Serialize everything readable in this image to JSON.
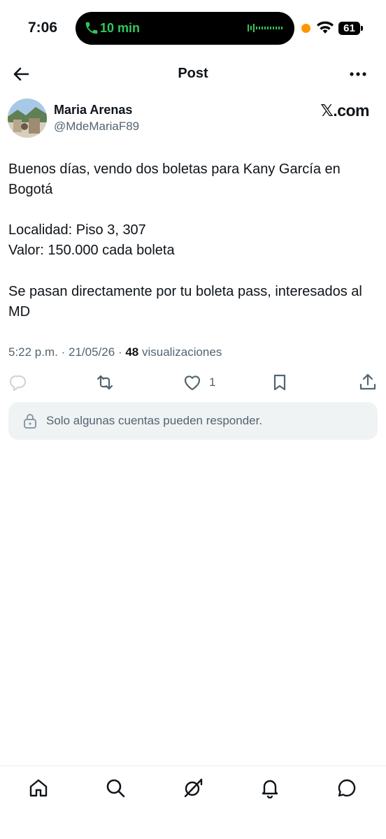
{
  "status_bar": {
    "time": "7:06",
    "call_duration": "10 min",
    "battery": "61",
    "call_color": "#34c759",
    "recording_dot_color": "#ff9500"
  },
  "header": {
    "title": "Post",
    "back_icon": "arrow-left-icon",
    "more_icon": "more-horizontal-icon"
  },
  "post": {
    "author_name": "Maria Arenas",
    "author_handle": "@MdeMariaF89",
    "brand": "𝕏.com",
    "text_lines": [
      "Buenos días, vendo dos boletas para Kany García en Bogotá",
      "Localidad: Piso 3, 307",
      "Valor: 150.000 cada boleta",
      "Se pasan directamente por tu boleta pass, interesados al MD"
    ],
    "meta": {
      "time": "5:22 p.m.",
      "separator": "·",
      "date": "21/05/26",
      "views_count": "48",
      "views_label": "visualizaciones"
    },
    "actions": {
      "reply_icon": "reply-icon",
      "repost_icon": "repost-icon",
      "like_icon": "heart-icon",
      "like_count": "1",
      "bookmark_icon": "bookmark-icon",
      "share_icon": "share-icon"
    },
    "reply_restriction": "Solo algunas cuentas pueden responder."
  },
  "bottom_nav": {
    "items": [
      "home-icon",
      "search-icon",
      "grok-icon",
      "notifications-icon",
      "messages-icon"
    ]
  },
  "colors": {
    "text_primary": "#0f1419",
    "text_secondary": "#536471",
    "panel_bg": "#eff3f4"
  }
}
